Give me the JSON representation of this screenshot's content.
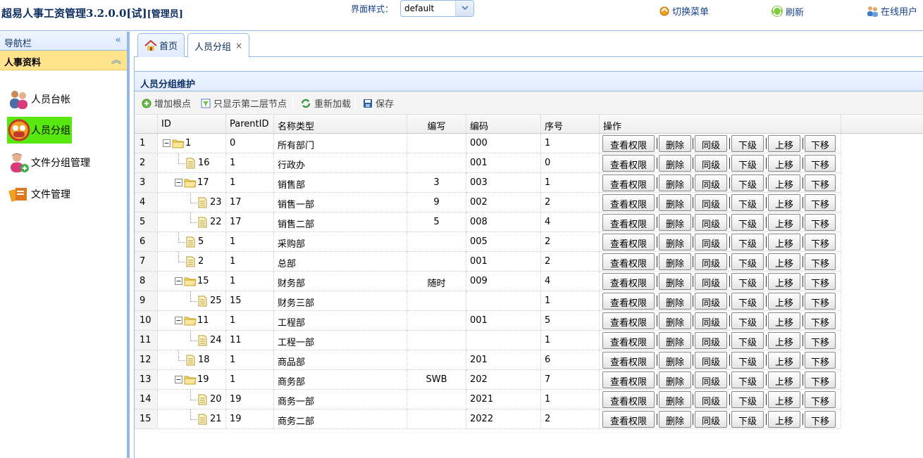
{
  "header": {
    "title": "超易人事工资管理3.2.0.0[试]",
    "role": "[管理员]",
    "theme_label": "界面样式：",
    "theme_value": "default",
    "switch_menu": "切换菜单",
    "refresh": "刷新",
    "online_users": "在线用户"
  },
  "nav": {
    "header": "导航栏",
    "section": "人事资料",
    "items": [
      {
        "label": "人员台帐",
        "icon": "users-icon"
      },
      {
        "label": "人员分组",
        "icon": "group-icon"
      },
      {
        "label": "文件分组管理",
        "icon": "user-add-icon"
      },
      {
        "label": "文件管理",
        "icon": "files-icon"
      }
    ]
  },
  "tabs": [
    {
      "label": "首页",
      "icon": "home-icon"
    },
    {
      "label": "人员分组",
      "close": "×"
    }
  ],
  "panel": {
    "title": "人员分组维护",
    "toolbar": {
      "add_root": "增加根点",
      "show_second": "只显示第二层节点",
      "reload": "重新加载",
      "save": "保存"
    }
  },
  "grid": {
    "columns": [
      "ID",
      "ParentID",
      "名称类型",
      "编写",
      "编码",
      "序号",
      "操作"
    ],
    "ops": [
      "查看权限",
      "删除",
      "同级",
      "下级",
      "上移",
      "下移"
    ],
    "rows": [
      {
        "rn": "1",
        "id": "1",
        "parent": "0",
        "name": "所有部门",
        "abbr": "",
        "code": "000",
        "seq": "1",
        "level": 0,
        "folder": true
      },
      {
        "rn": "2",
        "id": "16",
        "parent": "1",
        "name": "行政办",
        "abbr": "",
        "code": "001",
        "seq": "0",
        "level": 1,
        "folder": false
      },
      {
        "rn": "3",
        "id": "17",
        "parent": "1",
        "name": "销售部",
        "abbr": "3",
        "code": "003",
        "seq": "1",
        "level": 1,
        "folder": true
      },
      {
        "rn": "4",
        "id": "23",
        "parent": "17",
        "name": "销售一部",
        "abbr": "9",
        "code": "002",
        "seq": "2",
        "level": 2,
        "folder": false
      },
      {
        "rn": "5",
        "id": "22",
        "parent": "17",
        "name": "销售二部",
        "abbr": "5",
        "code": "008",
        "seq": "4",
        "level": 2,
        "folder": false
      },
      {
        "rn": "6",
        "id": "5",
        "parent": "1",
        "name": "采购部",
        "abbr": "",
        "code": "005",
        "seq": "2",
        "level": 1,
        "folder": false
      },
      {
        "rn": "7",
        "id": "2",
        "parent": "1",
        "name": "总部",
        "abbr": "",
        "code": "001",
        "seq": "2",
        "level": 1,
        "folder": false
      },
      {
        "rn": "8",
        "id": "15",
        "parent": "1",
        "name": "财务部",
        "abbr": "随时",
        "code": "009",
        "seq": "4",
        "level": 1,
        "folder": true
      },
      {
        "rn": "9",
        "id": "25",
        "parent": "15",
        "name": "财务三部",
        "abbr": "",
        "code": "",
        "seq": "1",
        "level": 2,
        "folder": false
      },
      {
        "rn": "10",
        "id": "11",
        "parent": "1",
        "name": "工程部",
        "abbr": "",
        "code": "001",
        "seq": "5",
        "level": 1,
        "folder": true
      },
      {
        "rn": "11",
        "id": "24",
        "parent": "11",
        "name": "工程一部",
        "abbr": "",
        "code": "",
        "seq": "1",
        "level": 2,
        "folder": false
      },
      {
        "rn": "12",
        "id": "18",
        "parent": "1",
        "name": "商品部",
        "abbr": "",
        "code": "201",
        "seq": "6",
        "level": 1,
        "folder": false
      },
      {
        "rn": "13",
        "id": "19",
        "parent": "1",
        "name": "商务部",
        "abbr": "SWB",
        "code": "202",
        "seq": "7",
        "level": 1,
        "folder": true
      },
      {
        "rn": "14",
        "id": "20",
        "parent": "19",
        "name": "商务一部",
        "abbr": "",
        "code": "2021",
        "seq": "1",
        "level": 2,
        "folder": false
      },
      {
        "rn": "15",
        "id": "21",
        "parent": "19",
        "name": "商务二部",
        "abbr": "",
        "code": "2022",
        "seq": "2",
        "level": 2,
        "folder": false
      }
    ]
  },
  "colors": {
    "border": "#95b8e7",
    "title_text": "#0e2d5f",
    "link_text": "#15428b",
    "section_bg": "#ffe48d",
    "active_item_bg": "#58e80f"
  }
}
